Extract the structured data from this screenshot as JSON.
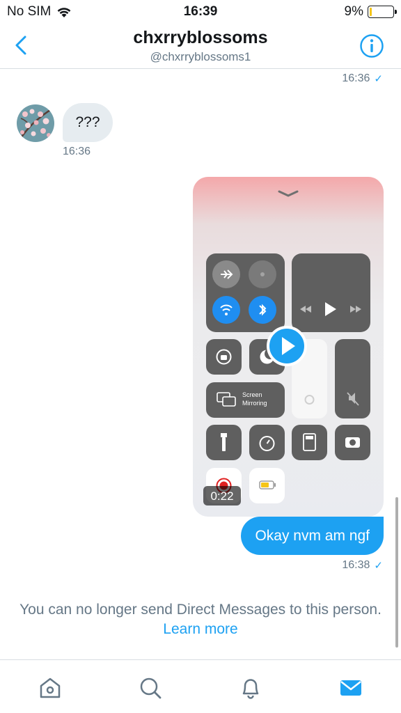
{
  "status_bar": {
    "carrier": "No SIM",
    "time": "16:39",
    "battery_percent": "9%",
    "battery_level": 0.09
  },
  "header": {
    "title": "chxrryblossoms",
    "handle": "@chxrryblossoms1"
  },
  "messages": {
    "previous_time": "16:36",
    "incoming_text": "???",
    "incoming_time": "16:36",
    "video_duration": "0:22",
    "outgoing_text": "Okay nvm am ngf",
    "outgoing_time": "16:38",
    "read_mark": "✓"
  },
  "video_thumbnail": {
    "screen_mirroring_line1": "Screen",
    "screen_mirroring_line2": "Mirroring"
  },
  "notice": {
    "text": "You can no longer send Direct Messages to this person.",
    "link": "Learn more"
  },
  "colors": {
    "accent": "#1da1f2",
    "secondary_text": "#657786",
    "bubble_gray": "#e6ecf0"
  },
  "tabs": [
    "home-icon",
    "search-icon",
    "bell-icon",
    "mail-icon"
  ]
}
